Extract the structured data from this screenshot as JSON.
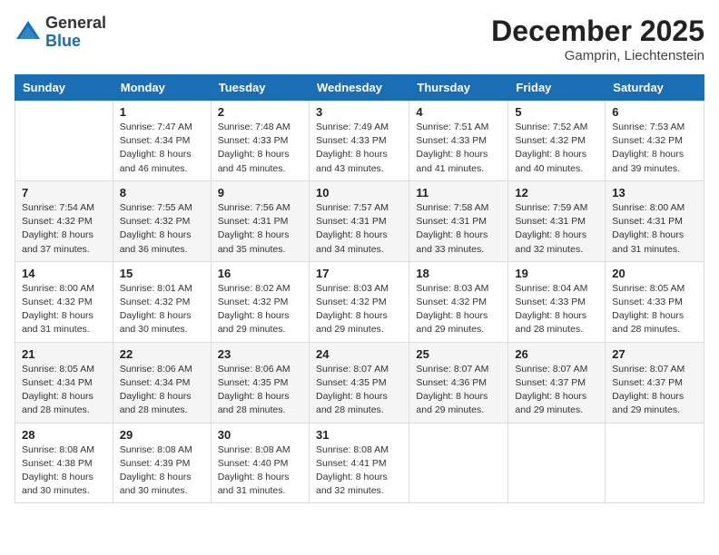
{
  "logo": {
    "general": "General",
    "blue": "Blue"
  },
  "header": {
    "month": "December 2025",
    "location": "Gamprin, Liechtenstein"
  },
  "weekdays": [
    "Sunday",
    "Monday",
    "Tuesday",
    "Wednesday",
    "Thursday",
    "Friday",
    "Saturday"
  ],
  "weeks": [
    [
      {
        "day": "",
        "sunrise": "",
        "sunset": "",
        "daylight": ""
      },
      {
        "day": "1",
        "sunrise": "Sunrise: 7:47 AM",
        "sunset": "Sunset: 4:34 PM",
        "daylight": "Daylight: 8 hours and 46 minutes."
      },
      {
        "day": "2",
        "sunrise": "Sunrise: 7:48 AM",
        "sunset": "Sunset: 4:33 PM",
        "daylight": "Daylight: 8 hours and 45 minutes."
      },
      {
        "day": "3",
        "sunrise": "Sunrise: 7:49 AM",
        "sunset": "Sunset: 4:33 PM",
        "daylight": "Daylight: 8 hours and 43 minutes."
      },
      {
        "day": "4",
        "sunrise": "Sunrise: 7:51 AM",
        "sunset": "Sunset: 4:33 PM",
        "daylight": "Daylight: 8 hours and 41 minutes."
      },
      {
        "day": "5",
        "sunrise": "Sunrise: 7:52 AM",
        "sunset": "Sunset: 4:32 PM",
        "daylight": "Daylight: 8 hours and 40 minutes."
      },
      {
        "day": "6",
        "sunrise": "Sunrise: 7:53 AM",
        "sunset": "Sunset: 4:32 PM",
        "daylight": "Daylight: 8 hours and 39 minutes."
      }
    ],
    [
      {
        "day": "7",
        "sunrise": "Sunrise: 7:54 AM",
        "sunset": "Sunset: 4:32 PM",
        "daylight": "Daylight: 8 hours and 37 minutes."
      },
      {
        "day": "8",
        "sunrise": "Sunrise: 7:55 AM",
        "sunset": "Sunset: 4:32 PM",
        "daylight": "Daylight: 8 hours and 36 minutes."
      },
      {
        "day": "9",
        "sunrise": "Sunrise: 7:56 AM",
        "sunset": "Sunset: 4:31 PM",
        "daylight": "Daylight: 8 hours and 35 minutes."
      },
      {
        "day": "10",
        "sunrise": "Sunrise: 7:57 AM",
        "sunset": "Sunset: 4:31 PM",
        "daylight": "Daylight: 8 hours and 34 minutes."
      },
      {
        "day": "11",
        "sunrise": "Sunrise: 7:58 AM",
        "sunset": "Sunset: 4:31 PM",
        "daylight": "Daylight: 8 hours and 33 minutes."
      },
      {
        "day": "12",
        "sunrise": "Sunrise: 7:59 AM",
        "sunset": "Sunset: 4:31 PM",
        "daylight": "Daylight: 8 hours and 32 minutes."
      },
      {
        "day": "13",
        "sunrise": "Sunrise: 8:00 AM",
        "sunset": "Sunset: 4:31 PM",
        "daylight": "Daylight: 8 hours and 31 minutes."
      }
    ],
    [
      {
        "day": "14",
        "sunrise": "Sunrise: 8:00 AM",
        "sunset": "Sunset: 4:32 PM",
        "daylight": "Daylight: 8 hours and 31 minutes."
      },
      {
        "day": "15",
        "sunrise": "Sunrise: 8:01 AM",
        "sunset": "Sunset: 4:32 PM",
        "daylight": "Daylight: 8 hours and 30 minutes."
      },
      {
        "day": "16",
        "sunrise": "Sunrise: 8:02 AM",
        "sunset": "Sunset: 4:32 PM",
        "daylight": "Daylight: 8 hours and 29 minutes."
      },
      {
        "day": "17",
        "sunrise": "Sunrise: 8:03 AM",
        "sunset": "Sunset: 4:32 PM",
        "daylight": "Daylight: 8 hours and 29 minutes."
      },
      {
        "day": "18",
        "sunrise": "Sunrise: 8:03 AM",
        "sunset": "Sunset: 4:32 PM",
        "daylight": "Daylight: 8 hours and 29 minutes."
      },
      {
        "day": "19",
        "sunrise": "Sunrise: 8:04 AM",
        "sunset": "Sunset: 4:33 PM",
        "daylight": "Daylight: 8 hours and 28 minutes."
      },
      {
        "day": "20",
        "sunrise": "Sunrise: 8:05 AM",
        "sunset": "Sunset: 4:33 PM",
        "daylight": "Daylight: 8 hours and 28 minutes."
      }
    ],
    [
      {
        "day": "21",
        "sunrise": "Sunrise: 8:05 AM",
        "sunset": "Sunset: 4:34 PM",
        "daylight": "Daylight: 8 hours and 28 minutes."
      },
      {
        "day": "22",
        "sunrise": "Sunrise: 8:06 AM",
        "sunset": "Sunset: 4:34 PM",
        "daylight": "Daylight: 8 hours and 28 minutes."
      },
      {
        "day": "23",
        "sunrise": "Sunrise: 8:06 AM",
        "sunset": "Sunset: 4:35 PM",
        "daylight": "Daylight: 8 hours and 28 minutes."
      },
      {
        "day": "24",
        "sunrise": "Sunrise: 8:07 AM",
        "sunset": "Sunset: 4:35 PM",
        "daylight": "Daylight: 8 hours and 28 minutes."
      },
      {
        "day": "25",
        "sunrise": "Sunrise: 8:07 AM",
        "sunset": "Sunset: 4:36 PM",
        "daylight": "Daylight: 8 hours and 29 minutes."
      },
      {
        "day": "26",
        "sunrise": "Sunrise: 8:07 AM",
        "sunset": "Sunset: 4:37 PM",
        "daylight": "Daylight: 8 hours and 29 minutes."
      },
      {
        "day": "27",
        "sunrise": "Sunrise: 8:07 AM",
        "sunset": "Sunset: 4:37 PM",
        "daylight": "Daylight: 8 hours and 29 minutes."
      }
    ],
    [
      {
        "day": "28",
        "sunrise": "Sunrise: 8:08 AM",
        "sunset": "Sunset: 4:38 PM",
        "daylight": "Daylight: 8 hours and 30 minutes."
      },
      {
        "day": "29",
        "sunrise": "Sunrise: 8:08 AM",
        "sunset": "Sunset: 4:39 PM",
        "daylight": "Daylight: 8 hours and 30 minutes."
      },
      {
        "day": "30",
        "sunrise": "Sunrise: 8:08 AM",
        "sunset": "Sunset: 4:40 PM",
        "daylight": "Daylight: 8 hours and 31 minutes."
      },
      {
        "day": "31",
        "sunrise": "Sunrise: 8:08 AM",
        "sunset": "Sunset: 4:41 PM",
        "daylight": "Daylight: 8 hours and 32 minutes."
      },
      {
        "day": "",
        "sunrise": "",
        "sunset": "",
        "daylight": ""
      },
      {
        "day": "",
        "sunrise": "",
        "sunset": "",
        "daylight": ""
      },
      {
        "day": "",
        "sunrise": "",
        "sunset": "",
        "daylight": ""
      }
    ]
  ]
}
